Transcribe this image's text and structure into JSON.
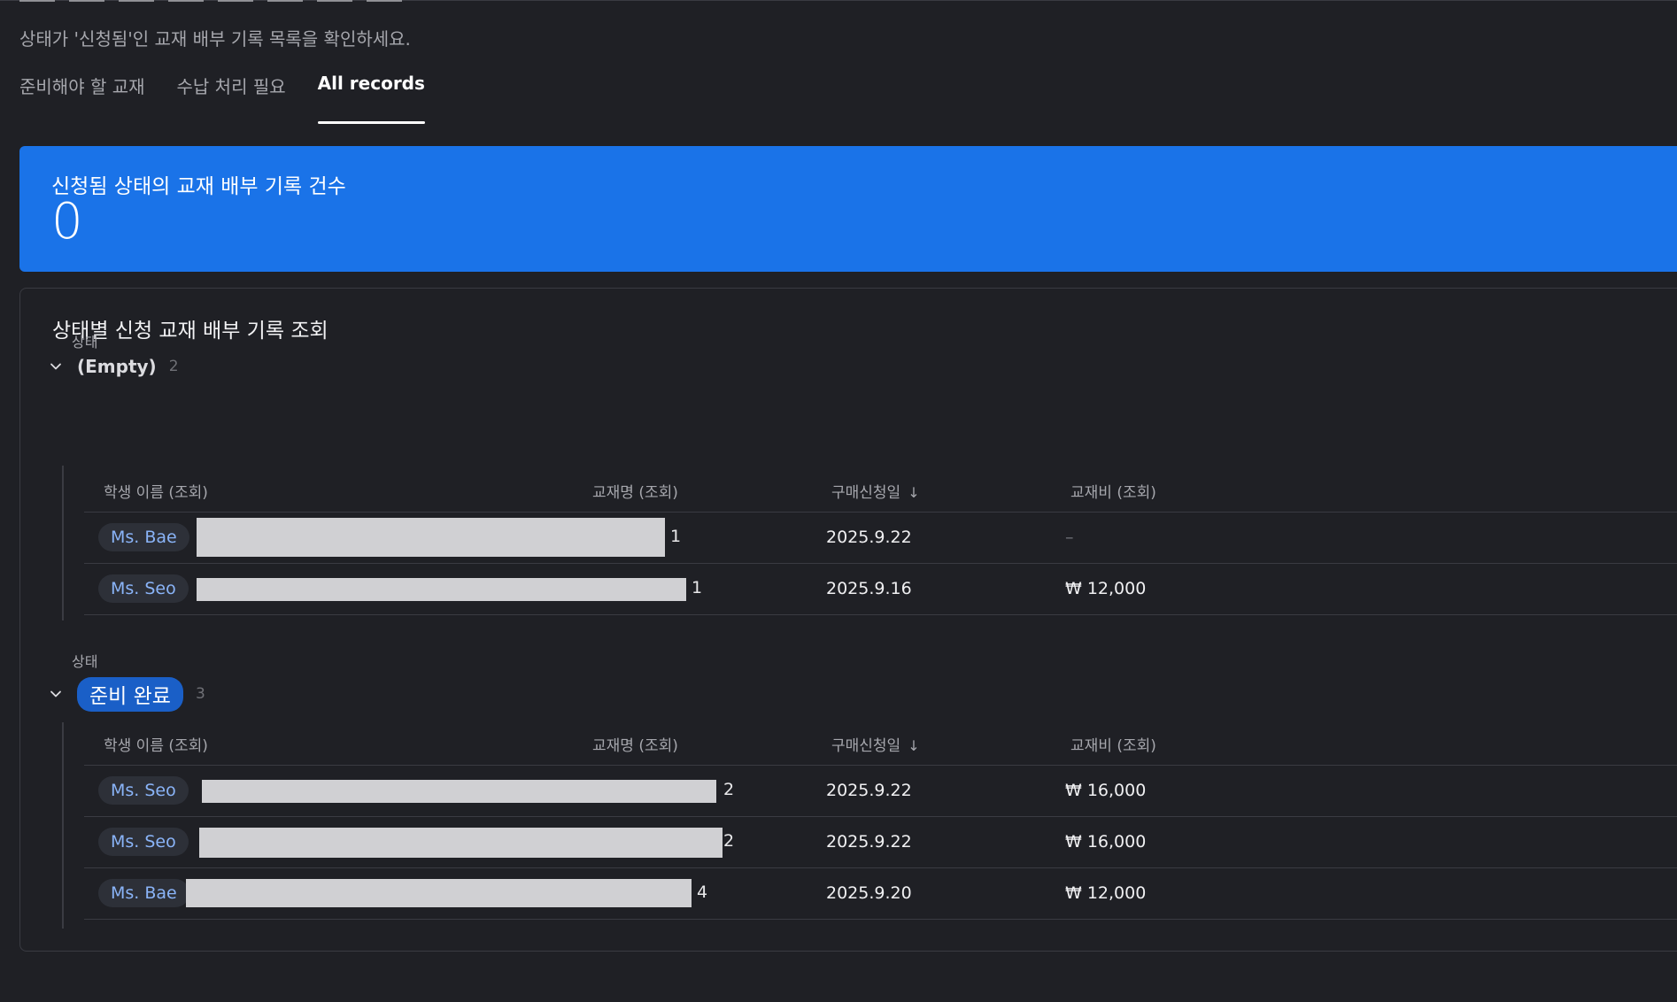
{
  "header": {
    "subtitle": "상태가 '신청됨'인 교재 배부 기록 목록을 확인하세요."
  },
  "tabs": [
    {
      "label": "준비해야 할 교재",
      "active": false
    },
    {
      "label": "수납 처리 필요",
      "active": false
    },
    {
      "label": "All records",
      "active": true
    }
  ],
  "summary": {
    "label": "신청됨 상태의 교재 배부 기록 건수",
    "value": "0",
    "color": "#1a73e8"
  },
  "panel": {
    "title": "상태별 신청 교재 배부 기록 조회",
    "columns": {
      "student": "학생 이름 (조회)",
      "book": "교재명 (조회)",
      "date": "구매신청일",
      "fee": "교재비 (조회)"
    },
    "groups": [
      {
        "caption": "상태",
        "name": "(Empty)",
        "count": "2",
        "rows": [
          {
            "student": "Ms. Bae",
            "book_tail": "1",
            "date": "2025.9.22",
            "fee": "–"
          },
          {
            "student": "Ms.  Seo",
            "book_tail": "1",
            "date": "2025.9.16",
            "fee": "₩ 12,000"
          }
        ]
      },
      {
        "caption": "상태",
        "name": "준비 완료",
        "count": "3",
        "rows": [
          {
            "student": "Ms.  Seo",
            "book_tail": "2",
            "date": "2025.9.22",
            "fee": "₩ 16,000"
          },
          {
            "student": "Ms.  Seo",
            "book_tail": "2",
            "date": "2025.9.22",
            "fee": "₩ 16,000"
          },
          {
            "student": "Ms. Bae",
            "book_tail": "4",
            "date": "2025.9.20",
            "fee": "₩ 12,000"
          }
        ]
      }
    ]
  },
  "icons": {
    "expand": "chevron-down-icon",
    "sort": "arrow-down-icon"
  }
}
